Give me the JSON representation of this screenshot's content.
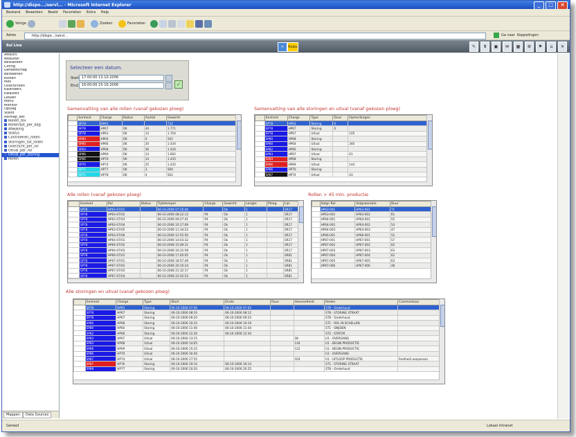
{
  "window": {
    "title": "http://dispo.../servl... - Microsoft Internet Explorer",
    "close": "×",
    "minimize": "_",
    "maximize": "□"
  },
  "menu": [
    "Bestand",
    "Bewerken",
    "Beeld",
    "Favorieten",
    "Extra",
    "Help"
  ],
  "toolbar": {
    "back": "Vorige",
    "search": "Zoeken",
    "favorites": "Favorieten"
  },
  "address": {
    "label": "Adres",
    "url": "http://dispo.../servl...",
    "go": "Ga naar",
    "links": "Koppelingen"
  },
  "app": {
    "title": "Rol Line",
    "btn_left": "»",
    "btn_right": "Rules"
  },
  "side_buttons": [
    "✎",
    "⬆",
    "▣",
    "✉",
    "▦",
    "⚙",
    "⚑",
    "⌂",
    "✕"
  ],
  "sidebar": {
    "items": [
      "Afkeurs",
      "Afkeuren",
      "Bestanden",
      "Config",
      "Gereedschap",
      "Berekenen",
      "Kosten",
      "Mes",
      "Overzichten",
      "Kalenders",
      "Kwaliteit",
      "Lessen",
      "Menu",
      "Monitor",
      "Opslag",
      "Stand",
      "Rolmap_det",
      "Rollen_tev",
      "Rollenlijst_per_dag",
      "Afwijking",
      "Status",
      "Controleren_rollen",
      "Storingen_tot_rollen",
      "Overzicht_per_rol",
      "Uitval_per_rol",
      "Uitval_per_storing",
      "Rollen"
    ],
    "tabs": [
      "Mappen",
      "Data Sources"
    ]
  },
  "date_select": {
    "title": "Selecteer een datum.",
    "start_label": "Start",
    "start_value": "17:00:00 13-10-2006",
    "end_label": "Eind",
    "end_value": "16:00:00 15-10-2006",
    "ok": "✓"
  },
  "sections": {
    "summary_rolls": "Samenvatting van alle rollen (vanaf gekozen ploeg)",
    "summary_faults": "Samenvatting van alle storingen en uitval (vanaf gekozen ploeg)",
    "all_rolls": "Alle rollen (vanaf gekozen ploeg)",
    "rolls_45": "Rollen > 45 min. productie",
    "all_faults": "Alle storingen en uitval (vanaf gekozen ploeg)"
  },
  "grid1": {
    "columns": [
      "",
      "Eenheid",
      "Charge",
      "Status",
      "Aantal",
      "Gewicht"
    ],
    "rows": [
      {
        "c": "#2e62d0",
        "v": [
          "",
          "SP78",
          "HP63",
          "",
          "",
          "732"
        ],
        "sel": true
      },
      {
        "c": "#1a1ae6",
        "v": [
          "",
          "SP78",
          "HP67",
          "OK",
          "44",
          "1.771"
        ]
      },
      {
        "c": "#1a1ae6",
        "v": [
          "",
          "SP78",
          "HP63",
          "OK",
          "14",
          "1.704"
        ]
      },
      {
        "c": "#e02020",
        "v": [
          "",
          "SP80",
          "HP64",
          "OK",
          "0",
          "502"
        ]
      },
      {
        "c": "#e02020",
        "v": [
          "",
          "SP80",
          "HP66",
          "OK",
          "20",
          "1.434"
        ]
      },
      {
        "c": "#1a1ae6",
        "v": [
          "",
          "SP83",
          "HP68",
          "OK",
          "36",
          "1.434"
        ]
      },
      {
        "c": "#111111",
        "v": [
          "",
          "SP86",
          "HP69",
          "OK",
          "14",
          "1.662"
        ]
      },
      {
        "c": "#111111",
        "v": [
          "",
          "SP86",
          "HP70",
          "OK",
          "14",
          "1.435"
        ]
      },
      {
        "c": "#1a1ae6",
        "v": [
          "",
          "SP70",
          "HP74",
          "OK",
          "25",
          "1.435"
        ]
      },
      {
        "c": "#22d8e8",
        "v": [
          "",
          "SP71",
          "HP77",
          "OK",
          "3",
          "560"
        ]
      },
      {
        "c": "#22d8e8",
        "v": [
          "",
          "SP71",
          "HP78",
          "OK",
          "4",
          "502"
        ]
      }
    ]
  },
  "grid2": {
    "columns": [
      "",
      "Eenheid",
      "Charge",
      "Type",
      "Duur",
      "Opmerkingen"
    ],
    "rows": [
      {
        "c": "#2e62d0",
        "v": [
          "",
          "SP78",
          "HP63",
          "Storing",
          "0",
          ""
        ],
        "sel": true
      },
      {
        "c": "#1a1ae6",
        "v": [
          "",
          "SP78",
          "HP67",
          "Storing",
          "0",
          ""
        ]
      },
      {
        "c": "#1a1ae6",
        "v": [
          "",
          "SP78",
          "HP67",
          "Uitval",
          "",
          "105"
        ]
      },
      {
        "c": "#1a1ae6",
        "v": [
          "",
          "SP80",
          "HP68",
          "Storing",
          "",
          ""
        ]
      },
      {
        "c": "#1a1ae6",
        "v": [
          "",
          "SP80",
          "HP64",
          "Uitval",
          "",
          "340"
        ]
      },
      {
        "c": "#1a1ae6",
        "v": [
          "",
          "SP82",
          "HP66",
          "Storing",
          "",
          ""
        ]
      },
      {
        "c": "#1a1ae6",
        "v": [
          "",
          "SP83",
          "HP67",
          "Uitval",
          "",
          "61"
        ]
      },
      {
        "c": "#e02020",
        "v": [
          "",
          "SP83",
          "HP68",
          "Storing",
          "",
          ""
        ]
      },
      {
        "c": "#e02020",
        "v": [
          "",
          "SP86",
          "HP69",
          "Uitval",
          "",
          "144"
        ]
      },
      {
        "c": "#1a1ae6",
        "v": [
          "",
          "SP86",
          "HP70",
          "Storing",
          "",
          ""
        ]
      },
      {
        "c": "#111111",
        "v": [
          "",
          "SP87",
          "HP74",
          "Uitval",
          "",
          "43"
        ]
      }
    ]
  },
  "grid3": {
    "columns": [
      "",
      "Eenheid",
      "Rol",
      "Status",
      "Tijdstempel",
      "Charge",
      "Gewicht",
      "Lengte",
      "Ploeg",
      "Lijn"
    ],
    "rows": [
      {
        "c": "#2e62d0",
        "v": [
          "",
          "SP78",
          "HP63-07/01",
          "",
          "06-10-2006 07:20:40",
          "",
          "Ok",
          "1",
          "",
          "SR17"
        ],
        "sel": true
      },
      {
        "c": "#1a1ae6",
        "v": [
          "",
          "SP78",
          "HP63-07/02",
          "",
          "06-10-2006 08:22:13",
          "P4",
          "Ok",
          "1",
          "",
          "SR17"
        ]
      },
      {
        "c": "#1a1ae6",
        "v": [
          "",
          "SP78",
          "HP63-07/03",
          "",
          "06-10-2006 09:27:41",
          "P4",
          "Ok",
          "1",
          "",
          "SR17"
        ]
      },
      {
        "c": "#1a1ae6",
        "v": [
          "",
          "SP78",
          "HP63-07/04",
          "",
          "06-10-2006 10:17:09",
          "P4",
          "Ok",
          "1",
          "",
          "SR17"
        ]
      },
      {
        "c": "#1a1ae6",
        "v": [
          "",
          "SP78",
          "HP63-07/05",
          "",
          "06-10-2006 11:34:22",
          "P4",
          "Ok",
          "1",
          "",
          "SR17"
        ]
      },
      {
        "c": "#1a1ae6",
        "v": [
          "",
          "SP78",
          "HP63-07/06",
          "",
          "06-10-2006 12:55:50",
          "P4",
          "Ok",
          "1",
          "",
          "SR17"
        ]
      },
      {
        "c": "#1a1ae6",
        "v": [
          "",
          "SP78",
          "HP64-07/01",
          "",
          "06-10-2006 14:03:32",
          "P4",
          "Ok",
          "1",
          "",
          "SR17"
        ]
      },
      {
        "c": "#1a1ae6",
        "v": [
          "",
          "SP78",
          "HP64-07/02",
          "",
          "06-10-2006 15:09:11",
          "P4",
          "Ok",
          "1",
          "",
          "SR17"
        ]
      },
      {
        "c": "#1a1ae6",
        "v": [
          "",
          "SP78",
          "HP64-07/03",
          "",
          "06-10-2006 16:22:58",
          "P4",
          "Ok",
          "1",
          "",
          "SR17"
        ]
      },
      {
        "c": "#1a1ae6",
        "v": [
          "",
          "SP78",
          "HP66-07/01",
          "",
          "06-10-2006 17:40:05",
          "P4",
          "Ok",
          "1",
          "",
          "SR81"
        ]
      },
      {
        "c": "#1a1ae6",
        "v": [
          "",
          "SP78",
          "HP67-07/01",
          "",
          "06-10-2006 18:57:49",
          "P4",
          "Ok",
          "1",
          "",
          "SR81"
        ]
      },
      {
        "c": "#1a1ae6",
        "v": [
          "",
          "SP78",
          "HP67-07/02",
          "",
          "06-10-2006 20:10:24",
          "P4",
          "Ok",
          "1",
          "",
          "SR81"
        ]
      },
      {
        "c": "#1a1ae6",
        "v": [
          "",
          "SP78",
          "HP67-07/03",
          "",
          "06-10-2006 21:32:17",
          "P4",
          "Ok",
          "1",
          "",
          "SR81"
        ]
      },
      {
        "c": "#1a1ae6",
        "v": [
          "",
          "SP78",
          "HP67-07/04",
          "",
          "06-10-2006 22:45:53",
          "P4",
          "Ok",
          "1",
          "",
          "SR81"
        ]
      }
    ]
  },
  "grid4": {
    "columns": [
      "",
      "Volgn Rol",
      "Volgnaanatie",
      "Duur"
    ],
    "rows": [
      {
        "v": [
          "",
          "HP63-001",
          "HP63-001",
          "71"
        ],
        "sel": true
      },
      {
        "v": [
          "",
          "HP63-002",
          "HP63-002",
          "61"
        ]
      },
      {
        "v": [
          "",
          "HP64-001",
          "HP64-001",
          "55"
        ]
      },
      {
        "v": [
          "",
          "HP64-002",
          "HP64-002",
          "54"
        ]
      },
      {
        "v": [
          "",
          "HP64-003",
          "HP64-003",
          "47"
        ]
      },
      {
        "v": [
          "",
          "HP66-001",
          "HP66-001",
          "52"
        ]
      },
      {
        "v": [
          "",
          "HP67-001",
          "HP67-001",
          "57"
        ]
      },
      {
        "v": [
          "",
          "HP67-002",
          "HP67-002",
          "62"
        ]
      },
      {
        "v": [
          "",
          "HP67-003",
          "HP67-003",
          "63"
        ]
      },
      {
        "v": [
          "",
          "HP67-004",
          "HP67-004",
          "62"
        ]
      },
      {
        "v": [
          "",
          "HP67-005",
          "HP67-005",
          "63"
        ]
      },
      {
        "v": [
          "",
          "HP67-006",
          "HP67-006",
          "48"
        ]
      }
    ]
  },
  "grid5": {
    "columns": [
      "",
      "Eenheid",
      "Charge",
      "Type",
      "Start",
      "Einde",
      "Duur",
      "Hoeveelheid",
      "Reden",
      "Commentaar"
    ],
    "rows": [
      {
        "c": "#2e62d0",
        "v": [
          "",
          "SP78",
          "HP63",
          "Storing",
          "06-10-2006 07:00",
          "06-10-2006 07:02",
          "",
          "",
          "ST8 - Onderhoud",
          ""
        ],
        "sel": true
      },
      {
        "c": "#1a1ae6",
        "v": [
          "",
          "SP78",
          "HP67",
          "Storing",
          "06-10-2006 08:10",
          "06-10-2006 08:12",
          "",
          "",
          "ST8 - STORING STRAAT",
          ""
        ]
      },
      {
        "c": "#1a1ae6",
        "v": [
          "",
          "SP78",
          "HP67",
          "Storing",
          "06-10-2006 09:20",
          "06-10-2006 09:24",
          "",
          "",
          "ST8 - Onderhoud",
          ""
        ]
      },
      {
        "c": "#1a1ae6",
        "v": [
          "",
          "SP80",
          "HP68",
          "Storing",
          "06-10-2006 10:15",
          "06-10-2006 10:19",
          "",
          "",
          "ST1 - ROL IN SCHELLEN",
          ""
        ]
      },
      {
        "c": "#1a1ae6",
        "v": [
          "",
          "SP80",
          "HP64",
          "Storing",
          "06-10-2006 11:40",
          "06-10-2006 11:44",
          "",
          "",
          "ST1 - SNIJDEN",
          ""
        ]
      },
      {
        "c": "#1a1ae6",
        "v": [
          "",
          "SP82",
          "HP66",
          "Storing",
          "06-10-2006 12:30",
          "06-10-2006 12:34",
          "",
          "",
          "ST2 - STATOR",
          ""
        ]
      },
      {
        "c": "#1a1ae6",
        "v": [
          "",
          "SP83",
          "HP67",
          "Uitval",
          "06-10-2006 13:15",
          "",
          "",
          "38",
          "U1 - OVERGANG",
          ""
        ]
      },
      {
        "c": "#1a1ae6",
        "v": [
          "",
          "SP83",
          "HP68",
          "Uitval",
          "06-10-2006 14:05",
          "",
          "",
          "134",
          "U1 - BEGIN PRODUCTIE",
          ""
        ]
      },
      {
        "c": "#1a1ae6",
        "v": [
          "",
          "SP86",
          "HP69",
          "Uitval",
          "06-10-2006 15:25",
          "",
          "",
          "122",
          "U1 - BEGIN PRODUCTIE",
          ""
        ]
      },
      {
        "c": "#1a1ae6",
        "v": [
          "",
          "SP86",
          "HP70",
          "Uitval",
          "06-10-2006 16:40",
          "",
          "",
          "",
          "U1 - OVERGANG",
          ""
        ]
      },
      {
        "c": "#1a1ae6",
        "v": [
          "",
          "SP87",
          "HP74",
          "Uitval",
          "06-10-2006 17:55",
          "",
          "",
          "103",
          "U1 - UITLOOP PRODUCTIE",
          "Snelheid aanpassen"
        ]
      },
      {
        "c": "#e02020",
        "v": [
          "",
          "SP87",
          "HP76",
          "Storing",
          "06-10-2006 19:10",
          "06-10-2006 19:14",
          "",
          "",
          "ST1 - STORING STRAAT",
          ""
        ]
      },
      {
        "c": "#1a1ae6",
        "v": [
          "",
          "SP88",
          "HP77",
          "Storing",
          "06-10-2006 20:20",
          "06-10-2006 20:25",
          "",
          "",
          "ST8 - Onderhoud",
          ""
        ]
      }
    ]
  },
  "status": {
    "left": "Gereed",
    "right": "Lokaal intranet"
  }
}
